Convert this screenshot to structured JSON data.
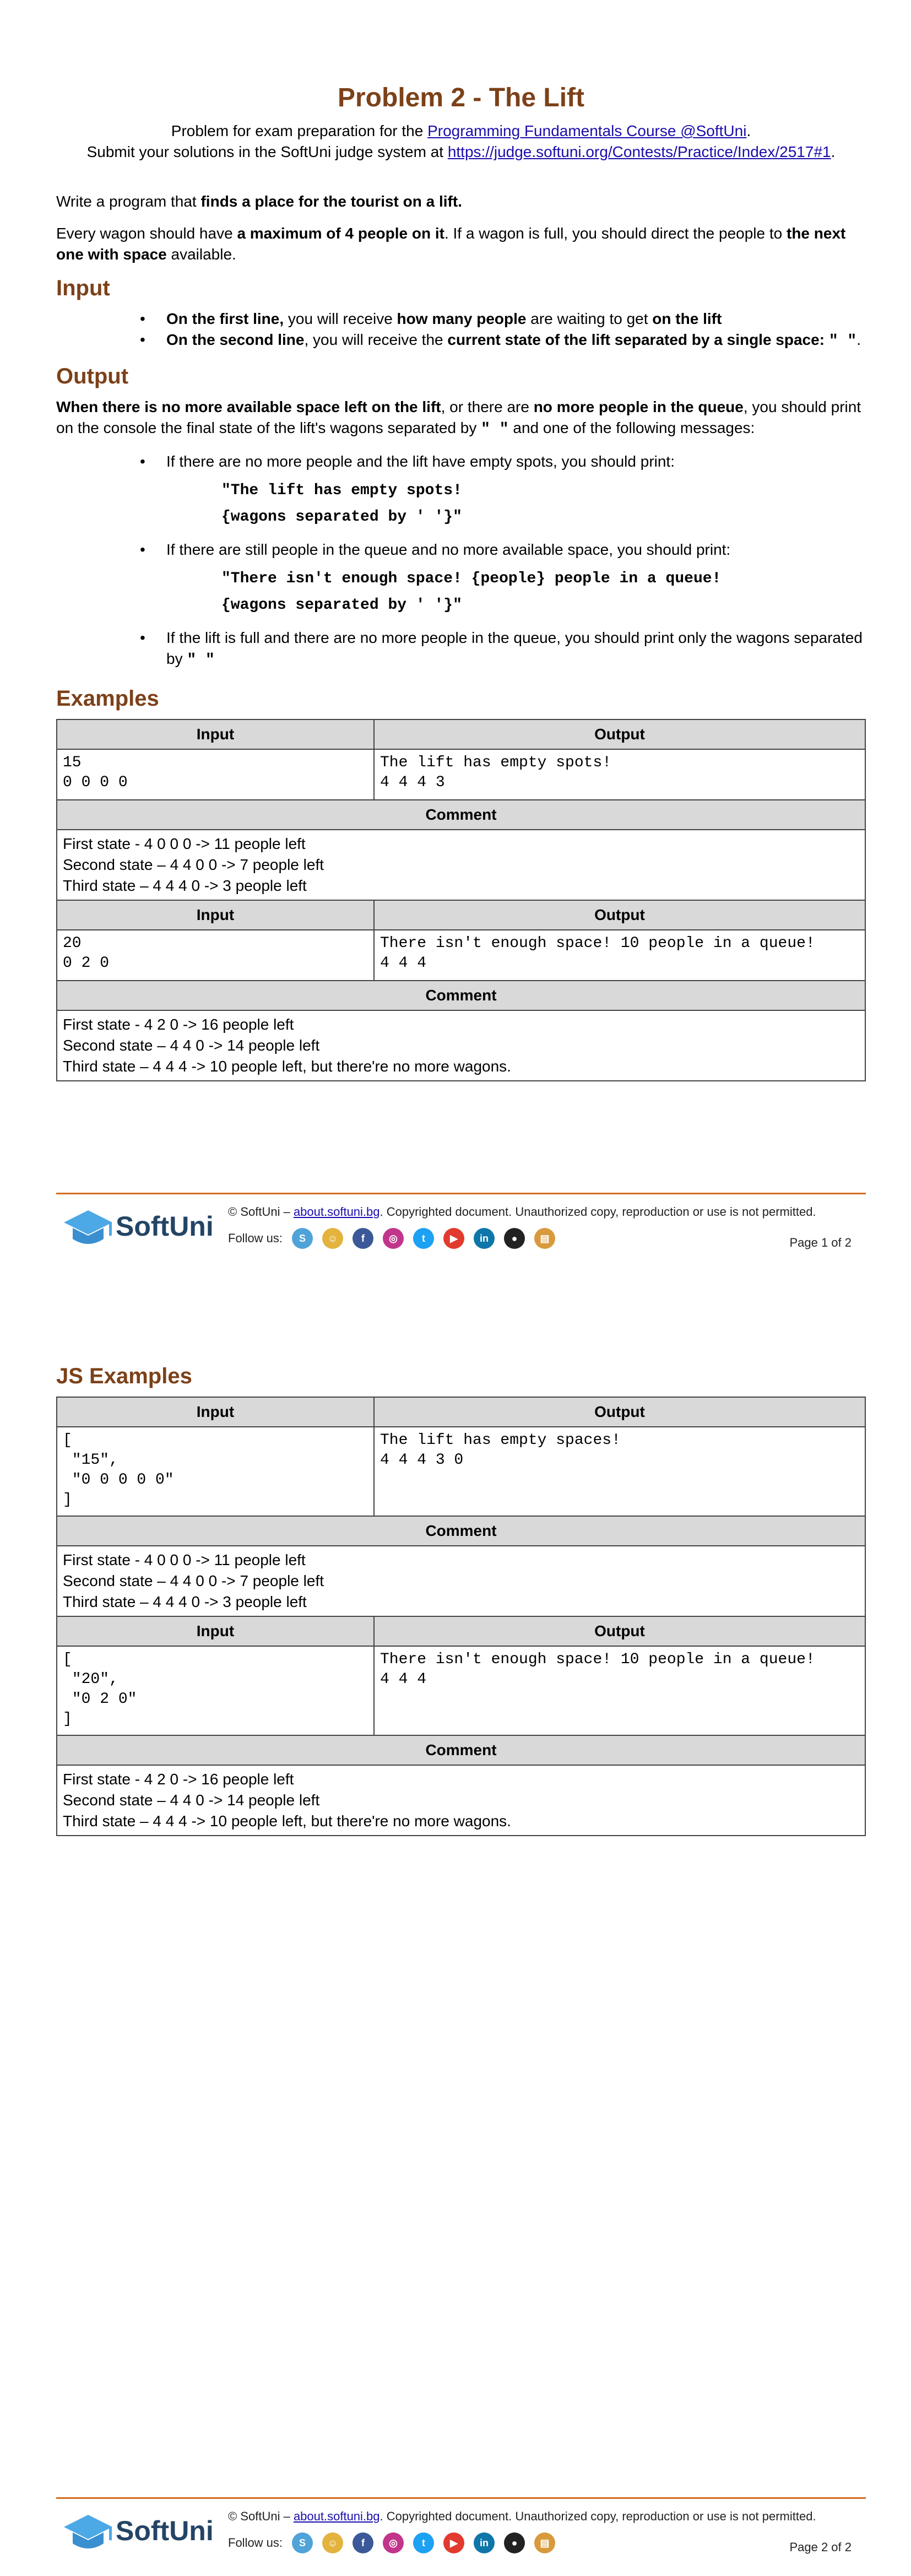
{
  "title": "Problem 2 - The Lift",
  "subtitle": {
    "line1_prefix": "Problem for exam preparation for the ",
    "line1_link": "Programming Fundamentals Course @SoftUni",
    "line1_suffix": ".",
    "line2_prefix": "Submit your solutions in the SoftUni judge system at ",
    "line2_link": "https://judge.softuni.org/Contests/Practice/Index/2517#1",
    "line2_suffix": "."
  },
  "intro": {
    "p1_a": "Write a program that ",
    "p1_b": "finds a place for the tourist on a lift.",
    "p2_a": "Every wagon should have ",
    "p2_b": "a maximum of 4 people on it",
    "p2_c": ". If a wagon is full, you should direct the people to ",
    "p2_d": "the next one with space",
    "p2_e": " available."
  },
  "input_section": {
    "heading": "Input",
    "b1_a": "On the first line,",
    "b1_b": " you will receive ",
    "b1_c": "how many people",
    "b1_d": " are waiting to get ",
    "b1_e": "on the lift",
    "b2_a": "On the second line",
    "b2_b": ", you will receive the ",
    "b2_c": "current state of the lift separated by a single space: ",
    "b2_d": "\" \"",
    "b2_e": "."
  },
  "output_section": {
    "heading": "Output",
    "p_a": "When there is no more available space left on the lift",
    "p_b": ", or there are ",
    "p_c": "no more people in the queue",
    "p_d": ", you should print on the console the final state of the lift's wagons separated by ",
    "p_e": "\" \"",
    "p_f": " and one of the following messages:",
    "b1": "If there are no more people and the lift have empty spots, you should print:",
    "b1_code1": "\"The lift has empty spots!",
    "b1_code2": "{wagons separated by ' '}\"",
    "b2": "If there are still people in the queue and no more available space, you should print:",
    "b2_code1": "\"There isn't enough space! {people} people in a queue!",
    "b2_code2": "{wagons separated by ' '}\"",
    "b3_a": "If the lift is full and there are no more people in the queue, you should print only the wagons separated by ",
    "b3_b": "\" \""
  },
  "examples": {
    "heading": "Examples",
    "input_header": "Input",
    "output_header": "Output",
    "comment_header": "Comment",
    "ex1_input": "15\n0 0 0 0",
    "ex1_output": "The lift has empty spots!\n4 4 4 3",
    "ex1_comment": [
      "First state - 4 0 0 0 -> 11 people left",
      "Second state – 4 4 0 0 -> 7 people left",
      "Third state – 4 4 4 0 -> 3 people left"
    ],
    "ex2_input": "20\n0 2 0",
    "ex2_output": "There isn't enough space! 10 people in a queue!\n4 4 4",
    "ex2_comment": [
      "First state - 4 2 0  -> 16 people left",
      "Second state – 4 4 0  -> 14 people left",
      "Third state – 4 4 4 -> 10 people left, but there're no more wagons."
    ]
  },
  "js_examples": {
    "heading": "JS Examples",
    "input_header": "Input",
    "output_header": "Output",
    "comment_header": "Comment",
    "ex1_input": "[\n \"15\",\n \"0 0 0 0 0\"\n]",
    "ex1_output": "The lift has empty spaces!\n4 4 4 3 0",
    "ex1_comment": [
      "First state - 4 0 0 0 -> 11 people left",
      "Second state – 4 4 0 0 -> 7 people left",
      "Third state – 4 4 4 0 -> 3 people left"
    ],
    "ex2_input": "[\n \"20\",\n \"0 2 0\"\n]",
    "ex2_output": "There isn't enough space! 10 people in a queue!\n4 4 4",
    "ex2_comment": [
      "First state - 4 2 0  -> 16 people left",
      "Second state – 4 4 0  -> 14 people left",
      "Third state – 4 4 4 -> 10 people left, but there're no more wagons."
    ]
  },
  "footer": {
    "logo_text": "SoftUni",
    "copy_prefix": "© SoftUni – ",
    "copy_link": "about.softuni.bg",
    "copy_suffix": ". Copyrighted document. Unauthorized copy, reproduction or use is not permitted.",
    "follow": "Follow us:",
    "page1": "Page 1 of 2",
    "page2": "Page 2 of 2",
    "icons": [
      {
        "name": "softuni-icon",
        "glyph": "S",
        "color": "#4fa3d9"
      },
      {
        "name": "softuni-kids-icon",
        "glyph": "☺",
        "color": "#e3b33e"
      },
      {
        "name": "facebook-icon",
        "glyph": "f",
        "color": "#3b5998"
      },
      {
        "name": "instagram-icon",
        "glyph": "◎",
        "color": "#c1358a"
      },
      {
        "name": "twitter-icon",
        "glyph": "t",
        "color": "#1da1f2"
      },
      {
        "name": "youtube-icon",
        "glyph": "▶",
        "color": "#e23a2e"
      },
      {
        "name": "linkedin-icon",
        "glyph": "in",
        "color": "#0e76a8"
      },
      {
        "name": "github-icon",
        "glyph": "●",
        "color": "#222222"
      },
      {
        "name": "softuni-store-icon",
        "glyph": "▤",
        "color": "#d89a3c"
      }
    ]
  }
}
